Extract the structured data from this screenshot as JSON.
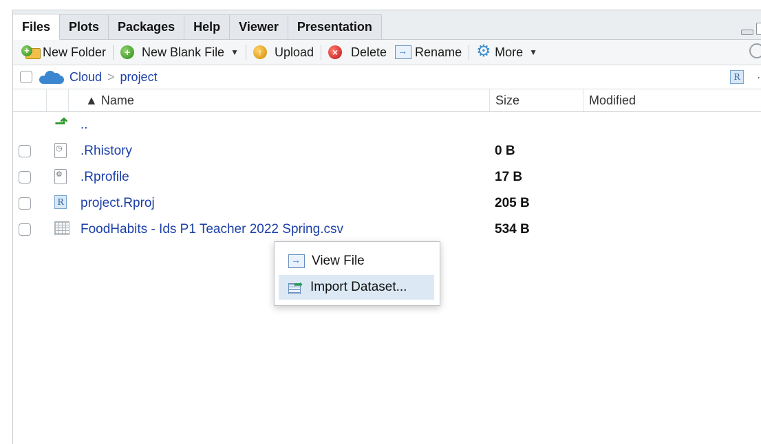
{
  "tabs": [
    "Files",
    "Plots",
    "Packages",
    "Help",
    "Viewer",
    "Presentation"
  ],
  "active_tab": "Files",
  "toolbar": {
    "new_folder": "New Folder",
    "new_blank_file": "New Blank File",
    "upload": "Upload",
    "delete": "Delete",
    "rename": "Rename",
    "more": "More"
  },
  "path": {
    "root": "Cloud",
    "folder": "project"
  },
  "columns": {
    "name": "▲ Name",
    "size": "Size",
    "modified": "Modified"
  },
  "parent_dir": "..",
  "files": [
    {
      "name": ".Rhistory",
      "size": "0 B",
      "icon": "history-file-icon"
    },
    {
      "name": ".Rprofile",
      "size": "17 B",
      "icon": "gear-file-icon"
    },
    {
      "name": "project.Rproj",
      "size": "205 B",
      "icon": "r-project-icon"
    },
    {
      "name": "FoodHabits - Ids P1 Teacher 2022 Spring.csv",
      "size": "534 B",
      "icon": "csv-file-icon"
    }
  ],
  "context_menu": {
    "view_file": "View File",
    "import_dataset": "Import Dataset..."
  },
  "colors": {
    "link": "#1b3fa8",
    "highlight": "#dce9f5",
    "toolbar": "#f5f6f7"
  }
}
